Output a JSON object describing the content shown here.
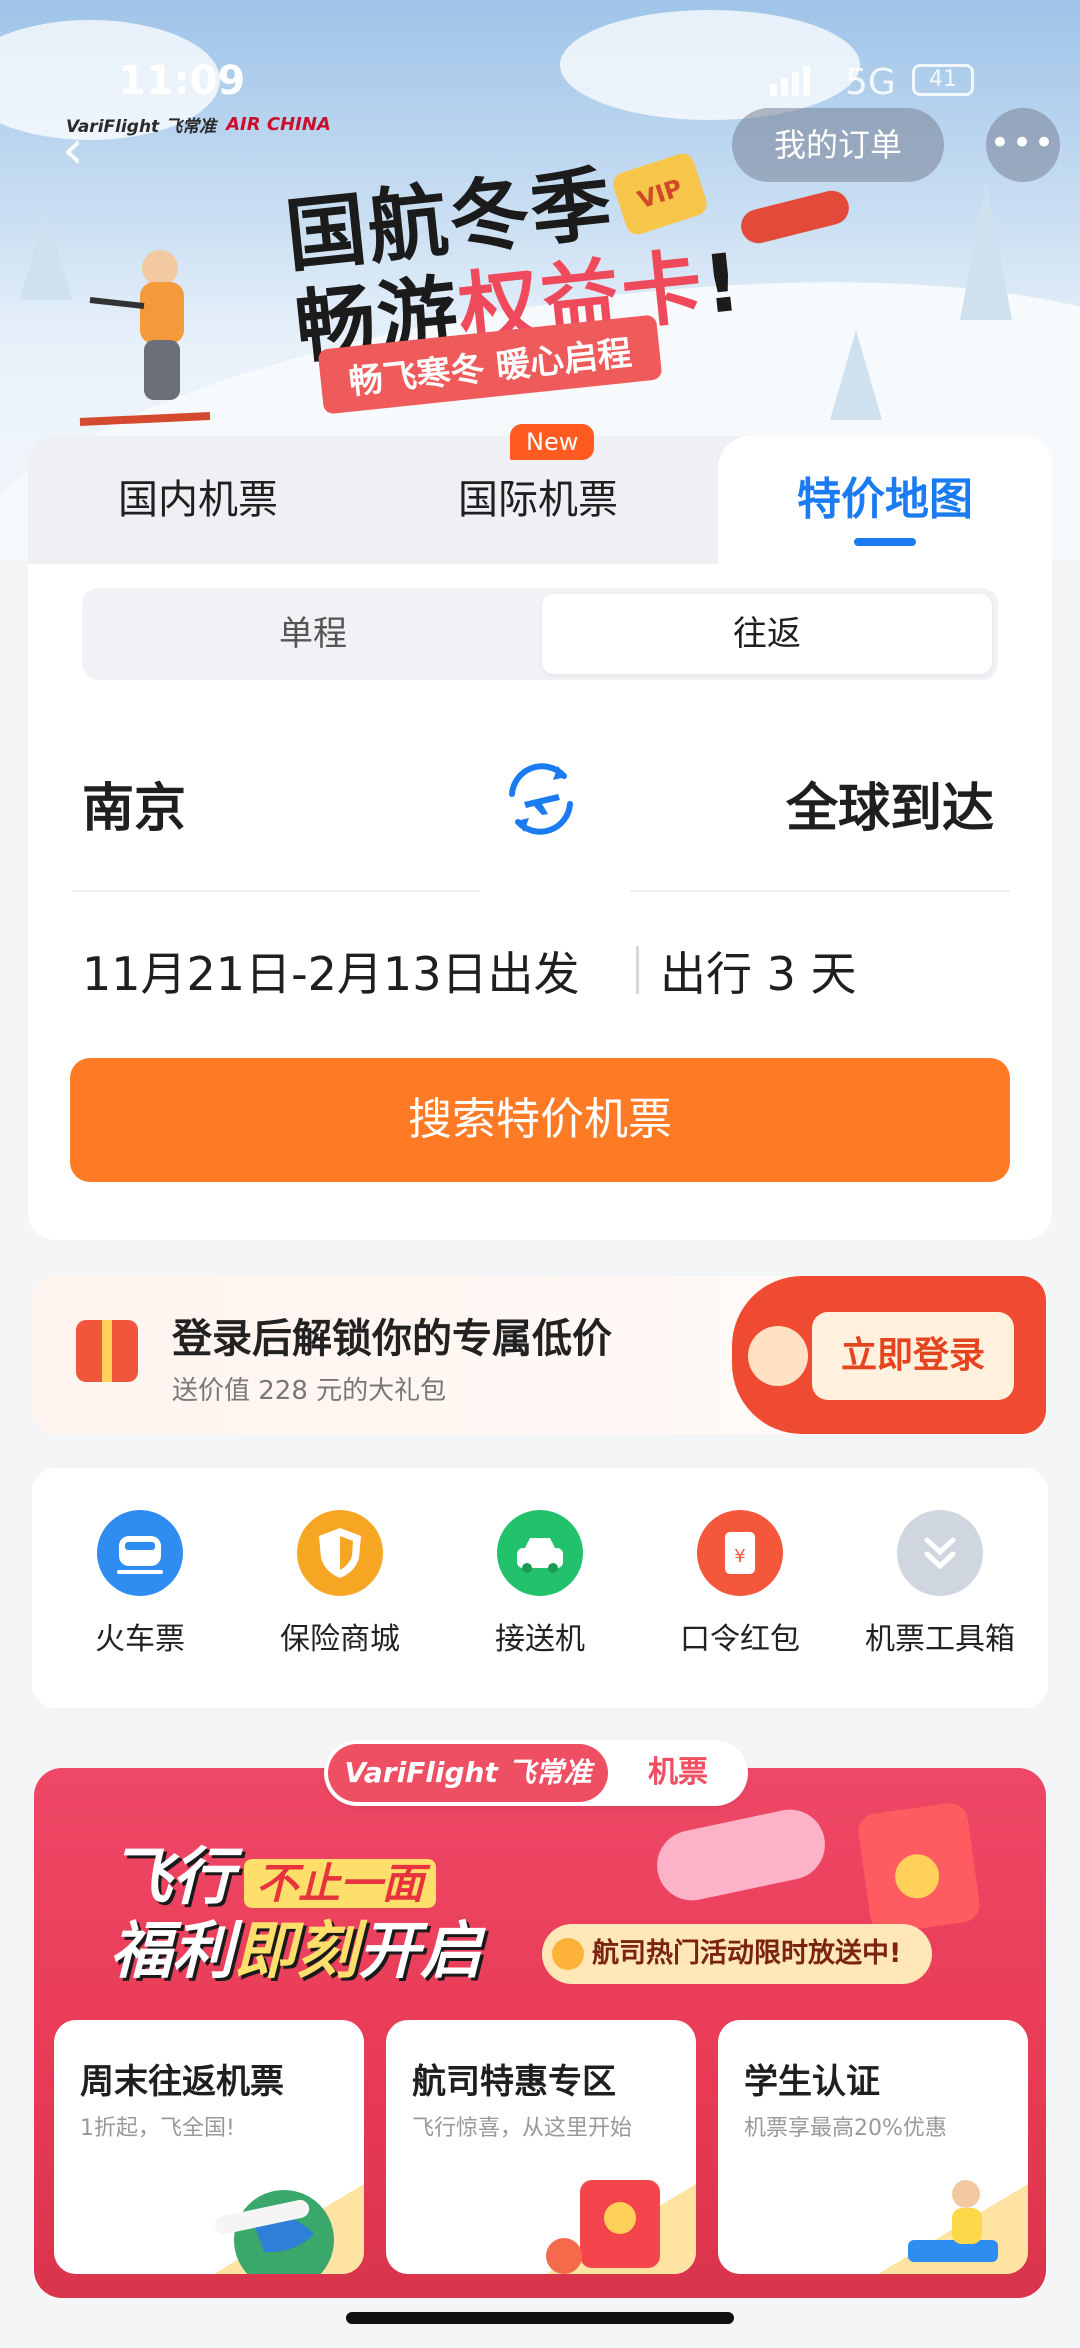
{
  "status_bar": {
    "time": "11:09",
    "network": "5G",
    "battery": "41"
  },
  "header": {
    "brand": "VariFlight 飞常准",
    "partner": "AIR CHINA",
    "orders_label": "我的订单",
    "more_label": "•••"
  },
  "banner": {
    "title_line1": "国航冬季",
    "title_line2_a": "畅游",
    "title_line2_b": "权益卡",
    "title_line2_c": "!",
    "tagline": "畅飞寒冬 暖心启程",
    "card_label": "VIP"
  },
  "search": {
    "tabs": [
      "国内机票",
      "国际机票",
      "特价地图"
    ],
    "new_badge": "New",
    "trip_types": [
      "单程",
      "往返"
    ],
    "from_city": "南京",
    "to_city": "全球到达",
    "dates": "11月21日-2月13日出发",
    "duration": "出行 3 天",
    "button": "搜索特价机票"
  },
  "login_promo": {
    "title": "登录后解锁你的专属低价",
    "subtitle": "送价值 228 元的大礼包",
    "button": "立即登录"
  },
  "quick_links": [
    {
      "label": "火车票",
      "icon": "train-icon",
      "color": "#2f8cf0"
    },
    {
      "label": "保险商城",
      "icon": "shield-icon",
      "color": "#f6a623"
    },
    {
      "label": "接送机",
      "icon": "car-icon",
      "color": "#22c16b"
    },
    {
      "label": "口令红包",
      "icon": "red-packet-icon",
      "color": "#f4573a"
    },
    {
      "label": "机票工具箱",
      "icon": "chevrons-down-icon",
      "color": "#cfd6e0"
    }
  ],
  "campaign": {
    "pill_brand": "VariFlight 飞常准",
    "pill_tag": "机票",
    "line1": "飞行",
    "line1_box": "不止一面",
    "line2_a": "福利",
    "line2_b": "即刻",
    "line2_c": "开启",
    "ribbon": "航司热门活动限时放送中!",
    "offers": [
      {
        "title": "周末往返机票",
        "subtitle": "1折起，飞全国!"
      },
      {
        "title": "航司特惠专区",
        "subtitle": "飞行惊喜，从这里开始"
      },
      {
        "title": "学生认证",
        "subtitle": "机票享最高20%优惠"
      }
    ]
  }
}
